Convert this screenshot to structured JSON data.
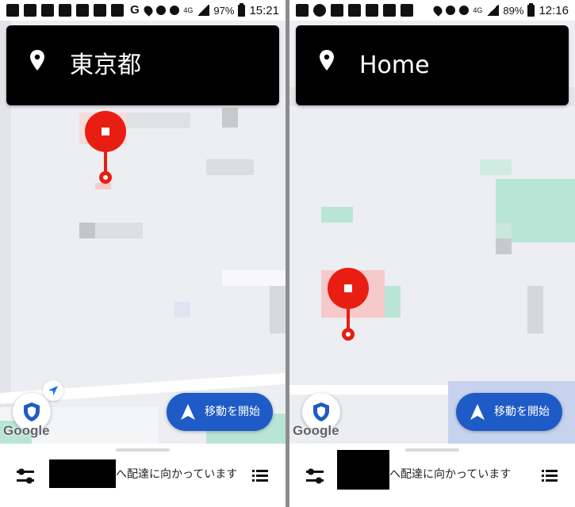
{
  "left": {
    "status_bar": {
      "battery": "97%",
      "time": "15:21",
      "network": "4G"
    },
    "header": {
      "title": "東京都"
    },
    "start_button": {
      "label": "移動を開始"
    },
    "map_attribution": "Google",
    "bottom_panel": {
      "status_text": "へ配達に向かっています"
    }
  },
  "right": {
    "status_bar": {
      "battery": "89%",
      "time": "12:16",
      "network": "4G"
    },
    "header": {
      "title": "Home"
    },
    "start_button": {
      "label": "移動を開始"
    },
    "map_attribution": "Google",
    "bottom_panel": {
      "status_text": "へ配達に向かっています"
    }
  },
  "colors": {
    "header_bg": "#000000",
    "marker_red": "#e81e12",
    "start_button_blue": "#1f5bc6",
    "map_bg": "#eceef2",
    "park_green": "#b9e5d6"
  },
  "icons": [
    "pin-icon",
    "shield-icon",
    "navigation-arrow-icon",
    "filter-icon",
    "list-icon",
    "my-location-icon"
  ]
}
